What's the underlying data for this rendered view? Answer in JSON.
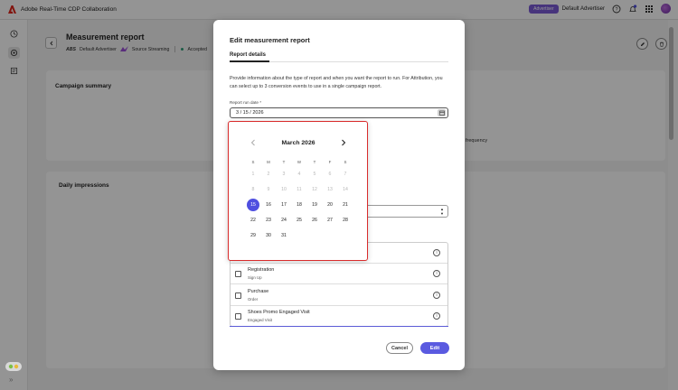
{
  "app": {
    "title": "Adobe Real-Time CDP Collaboration",
    "role_badge": "Advertiser",
    "org_name": "Default Advertiser"
  },
  "page": {
    "title": "Measurement report",
    "advertiser_logo_text": "ABS",
    "advertiser_name": "Default Advertiser",
    "source_name": "Source Streaming",
    "status": "Accepted",
    "campaign_summary_title": "Campaign summary",
    "frequency_label": "frequency",
    "daily_impressions_title": "Daily impressions"
  },
  "modal": {
    "title": "Edit measurement report",
    "tab": "Report details",
    "description": "Provide information about the type of report and when you want the report to run. For Attribution, you can select up to 3 conversion events to use in a single campaign report.",
    "date_label": "Report run date",
    "date_required": "*",
    "date_value": "3 / 15 / 2026",
    "events": [
      {
        "name": "Registration",
        "sub": "Sign Up"
      },
      {
        "name": "Purchase",
        "sub": "Order"
      },
      {
        "name": "Shoes Promo Engaged Visit",
        "sub": "Engaged Visit"
      }
    ],
    "cancel_label": "Cancel",
    "edit_label": "Edit"
  },
  "calendar": {
    "month_label": "March 2026",
    "weekdays": [
      "S",
      "M",
      "T",
      "W",
      "T",
      "F",
      "S"
    ],
    "weeks": [
      [
        "1",
        "2",
        "3",
        "4",
        "5",
        "6",
        "7"
      ],
      [
        "8",
        "9",
        "10",
        "11",
        "12",
        "13",
        "14"
      ],
      [
        "15",
        "16",
        "17",
        "18",
        "19",
        "20",
        "21"
      ],
      [
        "22",
        "23",
        "24",
        "25",
        "26",
        "27",
        "28"
      ],
      [
        "29",
        "30",
        "31",
        "",
        "",
        "",
        ""
      ]
    ],
    "selected_day": "15",
    "disabled_before_day": 15
  },
  "colors": {
    "accent": "#5a5ae0",
    "badge": "#7a5bd6",
    "highlight": "#d92c2c",
    "status_ok": "#2d9d78"
  },
  "icons": [
    "adobe-logo-icon",
    "help-icon",
    "bell-icon",
    "apps-grid-icon",
    "clock-icon",
    "collaboration-icon",
    "reports-icon",
    "edit-icon",
    "delete-icon",
    "calendar-icon",
    "chevron-left-icon",
    "chevron-right-icon",
    "info-icon",
    "expand-rail-icon"
  ]
}
